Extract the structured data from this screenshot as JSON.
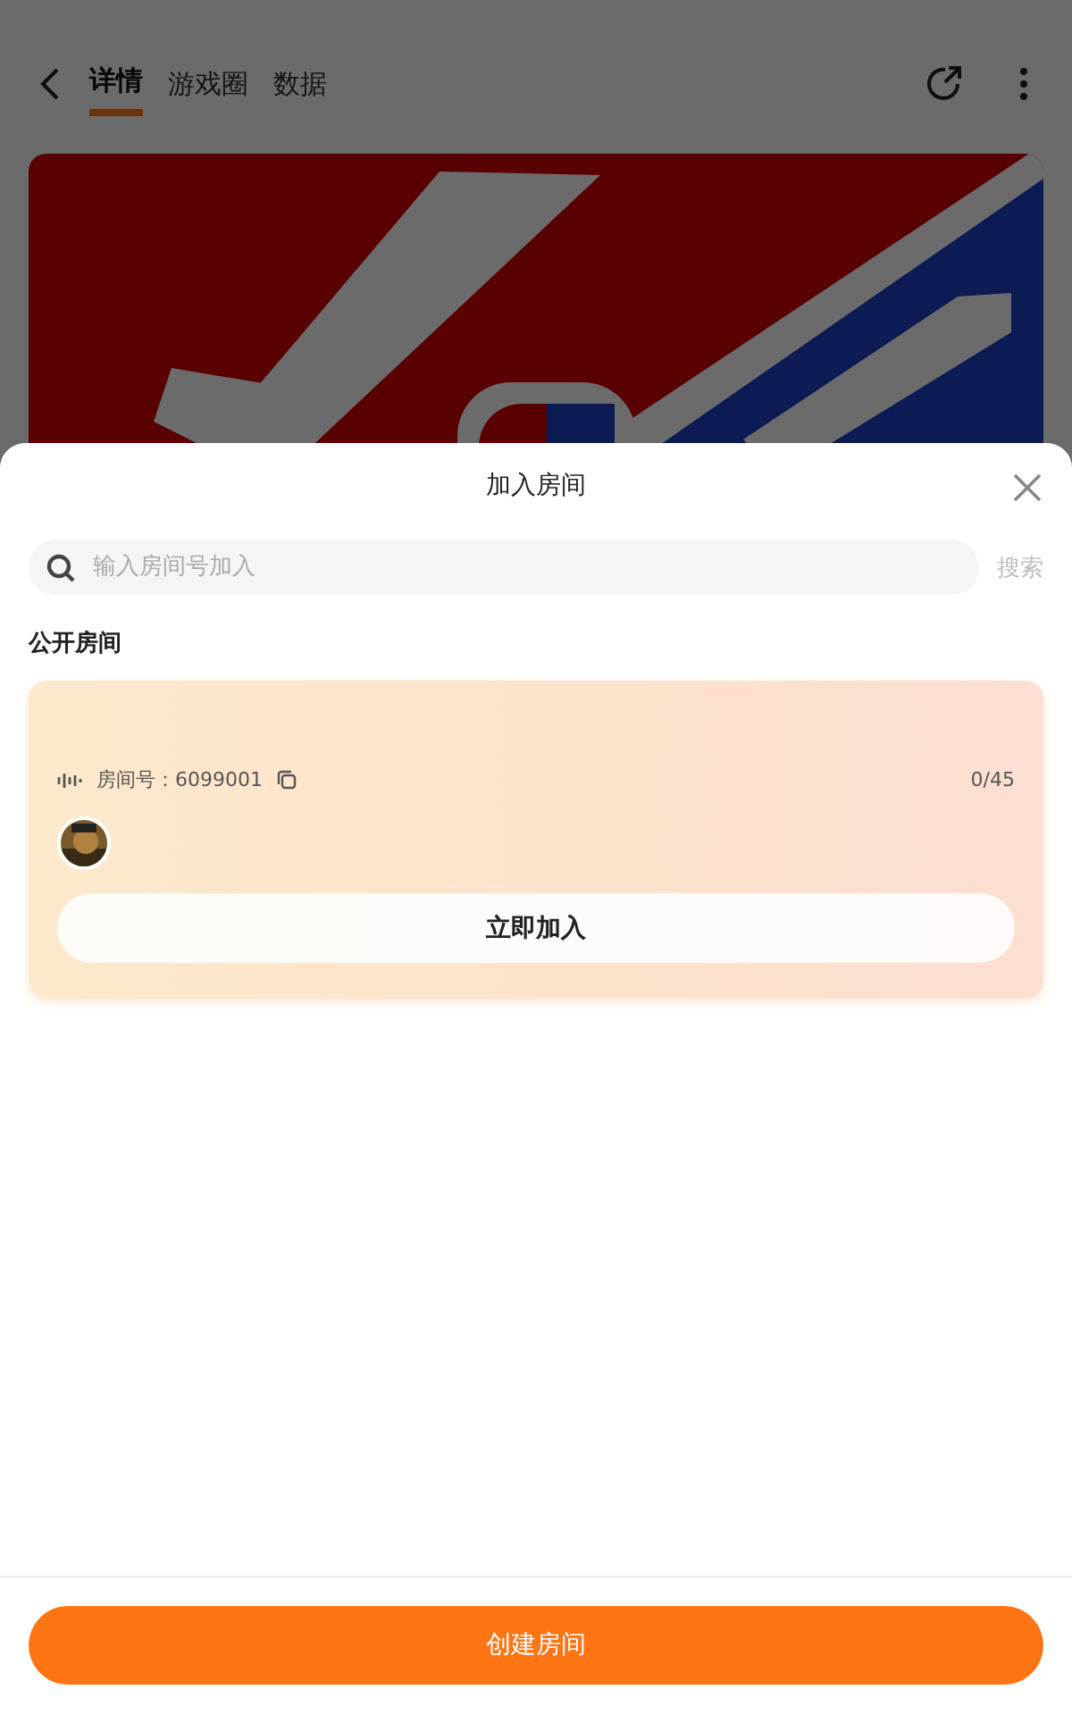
{
  "header": {
    "tabs": [
      {
        "label": "详情",
        "selected": true
      },
      {
        "label": "游戏圈",
        "selected": false
      },
      {
        "label": "数据",
        "selected": false
      }
    ]
  },
  "sheet": {
    "title": "加入房间",
    "search": {
      "placeholder": "输入房间号加入",
      "button": "搜索"
    },
    "section_title": "公开房间",
    "rooms": [
      {
        "room_label": "房间号：6099001",
        "occupancy": "0/45",
        "join_button": "立即加入"
      }
    ]
  },
  "create_button": "创建房间"
}
